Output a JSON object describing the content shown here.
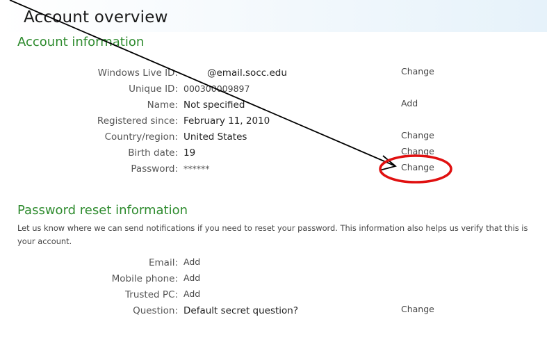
{
  "page_title": "Account overview",
  "account_info": {
    "title": "Account information",
    "rows": [
      {
        "label": "Windows Live ID:",
        "value": "@email.socc.edu",
        "action": "Change"
      },
      {
        "label": "Unique ID:",
        "value": "000300009897",
        "action": ""
      },
      {
        "label": "Name:",
        "value": "Not specified",
        "action": "Add"
      },
      {
        "label": "Registered since:",
        "value": "February 11, 2010",
        "action": ""
      },
      {
        "label": "Country/region:",
        "value": "United States",
        "action": "Change"
      },
      {
        "label": "Birth date:",
        "value": "19",
        "action": "Change"
      },
      {
        "label": "Password:",
        "value": "******",
        "action": "Change"
      }
    ]
  },
  "password_reset": {
    "title": "Password reset information",
    "description": "Let us know where we can send notifications if you need to reset your password. This information also helps us verify that this is your account.",
    "rows": [
      {
        "label": "Email:",
        "value": "Add",
        "action": ""
      },
      {
        "label": "Mobile phone:",
        "value": "Add",
        "action": ""
      },
      {
        "label": "Trusted PC:",
        "value": "Add",
        "action": ""
      },
      {
        "label": "Question:",
        "value": "Default secret question?",
        "action": "Change"
      }
    ]
  },
  "annotation": {
    "arrow_color": "#000000",
    "highlight_color": "#e01010"
  }
}
